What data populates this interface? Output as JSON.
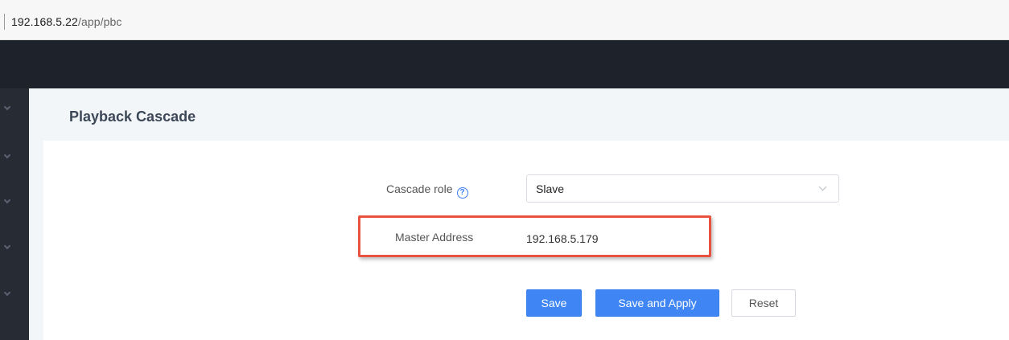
{
  "browser": {
    "url_host": "192.168.5.22",
    "url_path": "/app/pbc"
  },
  "page": {
    "title": "Playback Cascade"
  },
  "form": {
    "cascade_role": {
      "label": "Cascade role",
      "value": "Slave"
    },
    "master_address": {
      "label": "Master Address",
      "value": "192.168.5.179"
    }
  },
  "buttons": {
    "save": "Save",
    "save_apply": "Save and Apply",
    "reset": "Reset"
  },
  "colors": {
    "accent": "#3f86f4",
    "highlight": "#e8523f",
    "topbar": "#1d222b"
  }
}
